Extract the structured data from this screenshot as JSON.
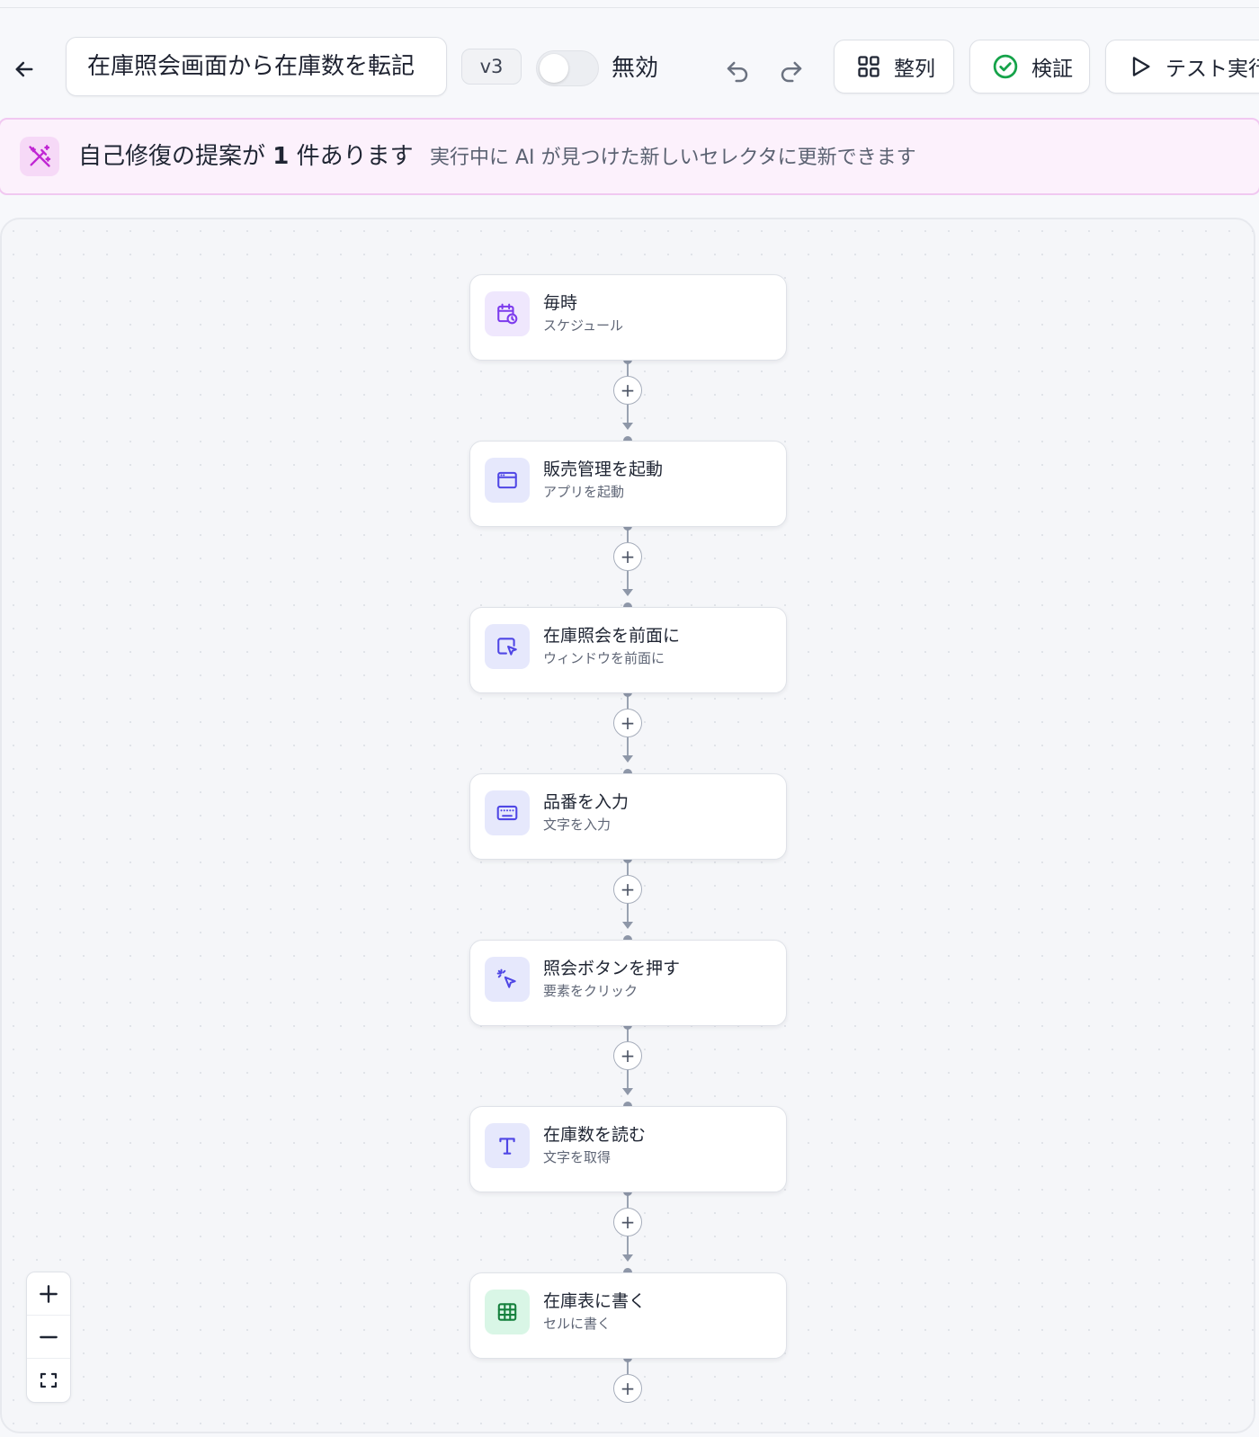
{
  "toolbar": {
    "title": "在庫照会画面から在庫数を転記",
    "version": "v3",
    "toggle_label": "無効",
    "arrange_label": "整列",
    "validate_label": "検証",
    "test_run_label": "テスト実行"
  },
  "banner": {
    "title_prefix": "自己修復の提案が ",
    "count": "1",
    "title_suffix": " 件あります",
    "subtitle": "実行中に AI が見つけた新しいセレクタに更新できます"
  },
  "nodes": [
    {
      "title": "毎時",
      "subtitle": "スケジュール",
      "icon": "calendar-clock-icon"
    },
    {
      "title": "販売管理を起動",
      "subtitle": "アプリを起動",
      "icon": "app-window-icon"
    },
    {
      "title": "在庫照会を前面に",
      "subtitle": "ウィンドウを前面に",
      "icon": "window-pointer-icon"
    },
    {
      "title": "品番を入力",
      "subtitle": "文字を入力",
      "icon": "keyboard-icon"
    },
    {
      "title": "照会ボタンを押す",
      "subtitle": "要素をクリック",
      "icon": "click-icon"
    },
    {
      "title": "在庫数を読む",
      "subtitle": "文字を取得",
      "icon": "text-icon"
    },
    {
      "title": "在庫表に書く",
      "subtitle": "セルに書く",
      "icon": "table-icon"
    }
  ],
  "add_label": "+",
  "colors": {
    "accent": "#4f46e5",
    "trigger": "#7c3aed",
    "sheet": "#15803d",
    "banner_accent": "#c026d3",
    "valid": "#16a34a"
  }
}
